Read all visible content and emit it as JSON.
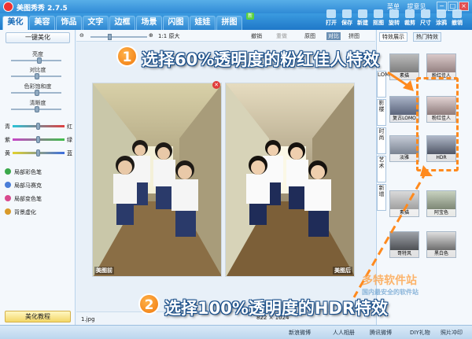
{
  "app": {
    "title": "美图秀秀 2.7.5"
  },
  "top_menu": [
    "菜单",
    "提意见"
  ],
  "window_controls": [
    "−",
    "□",
    "×"
  ],
  "nav_tabs": [
    "美化",
    "美容",
    "饰品",
    "文字",
    "边框",
    "场景",
    "闪图",
    "娃娃",
    "拼图"
  ],
  "nav_active": "美化",
  "nav_new_badge": "新",
  "toolbar": [
    "打开",
    "保存",
    "新建",
    "抠图",
    "旋转",
    "裁剪",
    "尺寸",
    "涂鸦",
    "撤销"
  ],
  "left": {
    "one_key_button": "一键美化",
    "sliders": [
      {
        "label": "亮度",
        "value": 0.55
      },
      {
        "label": "对比度",
        "value": 0.5
      },
      {
        "label": "色彩饱和度",
        "value": 0.5
      },
      {
        "label": "清晰度",
        "value": 0.5
      }
    ],
    "color_balance": [
      {
        "left": "青",
        "right": "红",
        "value": 0.5
      },
      {
        "left": "紫",
        "right": "绿",
        "value": 0.5
      },
      {
        "left": "黄",
        "right": "蓝",
        "value": 0.5
      }
    ],
    "tools": [
      "局部彩色笔",
      "局部马赛克",
      "局部变色笔",
      "背景虚化"
    ],
    "tutorial_button": "美化教程"
  },
  "canvas_bar": {
    "zoom_label": "1:1 原大",
    "undo": "撤销",
    "redo": "重做",
    "original": "原图",
    "compare": "对比",
    "share": "拼图"
  },
  "canvas": {
    "before_label": "美图前",
    "after_label": "美图后",
    "file_name": "1.jpg",
    "size_info": "822 × 1024"
  },
  "right": {
    "tabs": [
      "特效展示",
      "热门特效"
    ],
    "vtabs": [
      "LOMO",
      "影楼",
      "时尚",
      "艺术",
      "新增"
    ],
    "thumbs": [
      [
        "素描",
        "粉红佳人"
      ],
      [
        "复古LOMO",
        "粉红佳人"
      ],
      [
        "淡雅",
        "HDR"
      ],
      [
        "素描",
        "阿宝色"
      ],
      [
        "哥特风",
        "黑白色"
      ]
    ]
  },
  "status_bar": [
    "新浪微博",
    "人人相册",
    "腾讯微博",
    "DIY礼物",
    "照片冲印"
  ],
  "annotations": {
    "step1_num": "1",
    "step1_text": "选择60%透明度的粉红佳人特效",
    "step2_num": "2",
    "step2_text": "选择100%透明度的HDR特效",
    "accent": "#ff8a1e"
  },
  "watermark": {
    "line1": "多特软件站",
    "line2": "国内最安全的软件站"
  }
}
